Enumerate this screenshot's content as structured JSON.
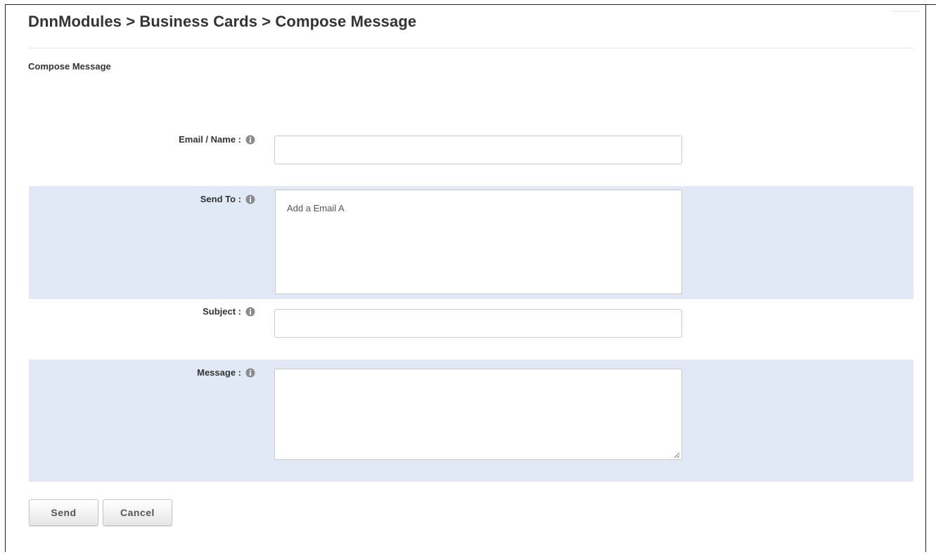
{
  "page": {
    "breadcrumb": "DnnModules > Business Cards > Compose Message",
    "section_title": "Compose Message"
  },
  "form": {
    "email_name": {
      "label": "Email / Name :",
      "value": "",
      "placeholder": ""
    },
    "send_to": {
      "label": "Send To :",
      "placeholder": "Add a Email A"
    },
    "subject": {
      "label": "Subject :",
      "value": "",
      "placeholder": ""
    },
    "message": {
      "label": "Message :",
      "value": "",
      "placeholder": ""
    }
  },
  "buttons": {
    "send_label": "Send",
    "cancel_label": "Cancel"
  },
  "icons": {
    "field_help": "info-icon"
  },
  "colors": {
    "shaded_row": "#e2e9f6",
    "text": "#333333",
    "border": "#c9c9c9"
  }
}
